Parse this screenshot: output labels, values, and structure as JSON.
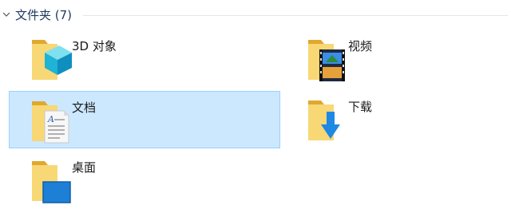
{
  "group": {
    "title": "文件夹 (7)"
  },
  "items": [
    {
      "label": "3D 对象",
      "icon": "folder-3d-objects-icon",
      "selected": false
    },
    {
      "label": "视频",
      "icon": "folder-videos-icon",
      "selected": false
    },
    {
      "label": "文档",
      "icon": "folder-documents-icon",
      "selected": true
    },
    {
      "label": "下载",
      "icon": "folder-downloads-icon",
      "selected": false
    },
    {
      "label": "桌面",
      "icon": "folder-desktop-icon",
      "selected": false
    }
  ],
  "colors": {
    "selection_fill": "#cce8ff",
    "selection_border": "#99d1ff",
    "folder_yellow": "#f8d775",
    "folder_dark": "#e0a82e",
    "download_blue": "#1e88e5",
    "desktop_blue": "#1e7fd6"
  }
}
